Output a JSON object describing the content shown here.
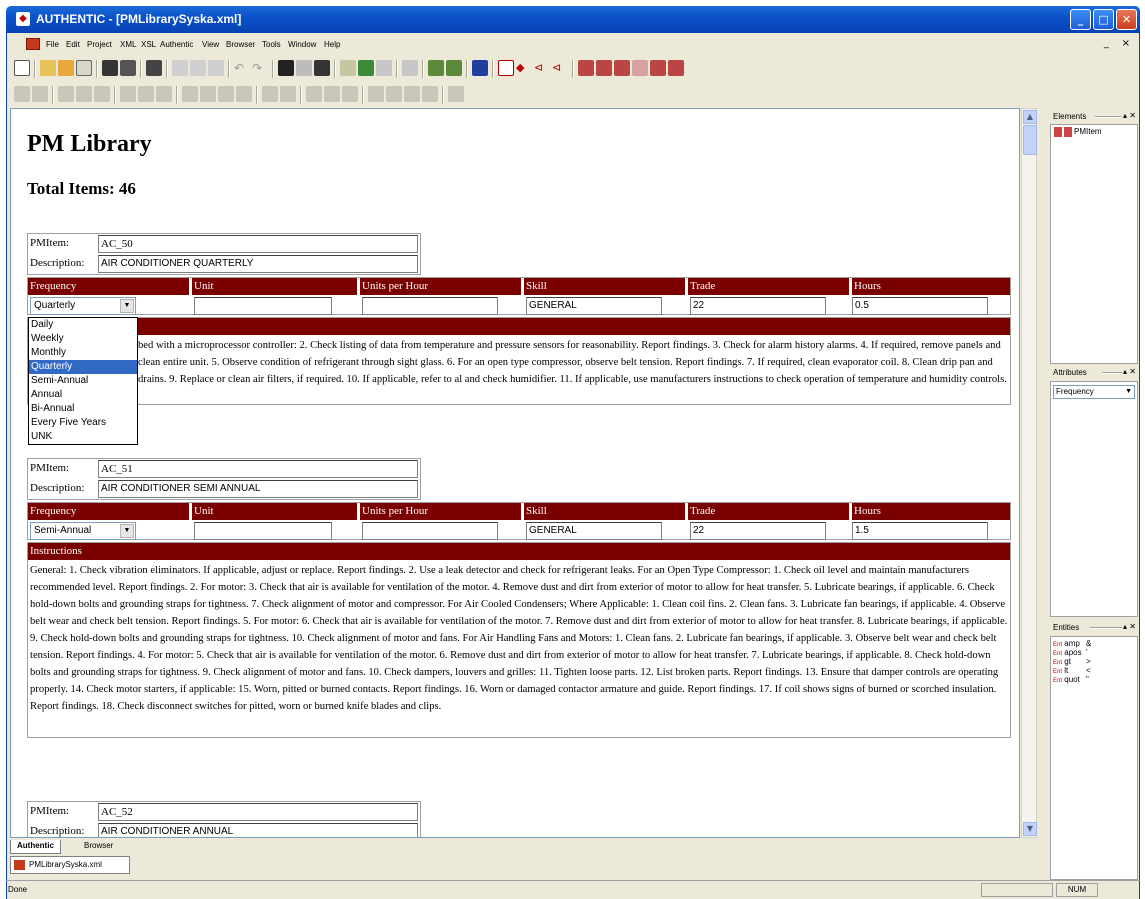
{
  "window": {
    "title": "AUTHENTIC - [PMLibrarySyska.xml]"
  },
  "menu": [
    "File",
    "Edit",
    "Project",
    "XML",
    "XSL",
    "Authentic",
    "View",
    "Browser",
    "Tools",
    "Window",
    "Help"
  ],
  "mdi_controls": "_    ×",
  "document": {
    "title": "PM Library",
    "total": "Total Items: 46",
    "labels": {
      "pmitem": "PMItem:",
      "description": "Description:",
      "frequency": "Frequency",
      "unit": "Unit",
      "units_per_hour": "Units per Hour",
      "skill": "Skill",
      "trade": "Trade",
      "hours": "Hours",
      "instructions": "Instructions"
    },
    "items": [
      {
        "id": "AC_50",
        "description": "AIR CONDITIONER QUARTERLY",
        "frequency": "Quarterly",
        "skill": "GENERAL",
        "trade": "22",
        "hours": "0.5",
        "instructions_visible": "bed with a microprocessor controller: 2. Check listing of data from temperature and pressure sensors for reasonability.  Report findings. 3. Check for alarm history alarms. 4. If required, remove panels and clean entire unit. 5. Observe condition of refrigerant through sight glass. 6. For an open type compressor, observe belt tension. Report findings. 7. If required, clean evaporator coil. 8. Clean drip pan and drains. 9. Replace or clean air filters, if required. 10. If applicable, refer to al and check humidifier. 11. If applicable, use manufacturers instructions to check operation of temperature and humidity controls."
      },
      {
        "id": "AC_51",
        "description": "AIR CONDITIONER SEMI ANNUAL",
        "frequency": "Semi-Annual",
        "skill": "GENERAL",
        "trade": "22",
        "hours": "1.5",
        "instructions": "General: 1. Check vibration eliminators. If applicable, adjust or replace. Report findings. 2. Use a leak detector and check for refrigerant leaks.  For an Open Type Compressor: 1. Check oil level and maintain manufacturers recommended level.  Report findings. 2. For motor: 3. Check that air is available for ventilation of the motor. 4. Remove dust and dirt from exterior of motor to allow for heat transfer. 5. Lubricate bearings, if applicable. 6. Check hold-down bolts and grounding straps for tightness. 7. Check alignment of motor and compressor.  For Air Cooled Condensers; Where Applicable: 1. Clean coil fins. 2. Clean fans. 3. Lubricate fan bearings, if applicable. 4. Observe belt wear and check belt tension. Report findings. 5. For motor: 6. Check that air is available for ventilation of the motor. 7. Remove dust and dirt from exterior of motor to allow for heat transfer. 8. Lubricate bearings, if applicable. 9. Check hold-down bolts and grounding straps for tightness. 10. Check alignment of motor and fans.  For Air Handling Fans and Motors: 1. Clean fans. 2. Lubricate fan bearings, if applicable. 3. Observe belt wear and check belt tension.  Report findings. 4. For motor: 5. Check that air is available for ventilation of the motor. 6. Remove dust and dirt from exterior of  motor to allow for heat transfer. 7. Lubricate bearings, if applicable. 8. Check hold-down bolts and grounding straps for tightness. 9. Check alignment of motor and fans. 10. Check dampers, louvers and grilles: 11. Tighten loose parts. 12. List broken parts.  Report findings. 13. Ensure that damper controls are operating properly. 14. Check motor starters, if applicable: 15. Worn, pitted or burned contacts. Report findings. 16. Worn or damaged contactor armature and guide. Report findings. 17. If coil shows signs of burned or scorched insulation. Report findings. 18. Check disconnect switches for pitted, worn or burned knife blades and clips."
      },
      {
        "id": "AC_52",
        "description": "AIR CONDITIONER ANNUAL"
      }
    ],
    "frequency_options": [
      "Daily",
      "Weekly",
      "Monthly",
      "Quarterly",
      "Semi-Annual",
      "Annual",
      "Bi-Annual",
      "Every Five Years",
      "UNK"
    ],
    "frequency_selected": "Quarterly"
  },
  "panes": {
    "elements": {
      "title": "Elements",
      "items": [
        "PMItem"
      ]
    },
    "attributes": {
      "title": "Attributes",
      "selected": "Frequency"
    },
    "entities": {
      "title": "Entities",
      "items": [
        {
          "tag": "Ent",
          "name": "amp",
          "value": "&"
        },
        {
          "tag": "Ent",
          "name": "apos",
          "value": "'"
        },
        {
          "tag": "Ent",
          "name": "gt",
          "value": ">"
        },
        {
          "tag": "Ent",
          "name": "lt",
          "value": "<"
        },
        {
          "tag": "Ent",
          "name": "quot",
          "value": "\""
        }
      ]
    }
  },
  "view_tabs": [
    "Authentic",
    "Browser"
  ],
  "file_tab": "PMLibrarySyska.xml",
  "status": {
    "text": "Done",
    "num": "NUM"
  }
}
